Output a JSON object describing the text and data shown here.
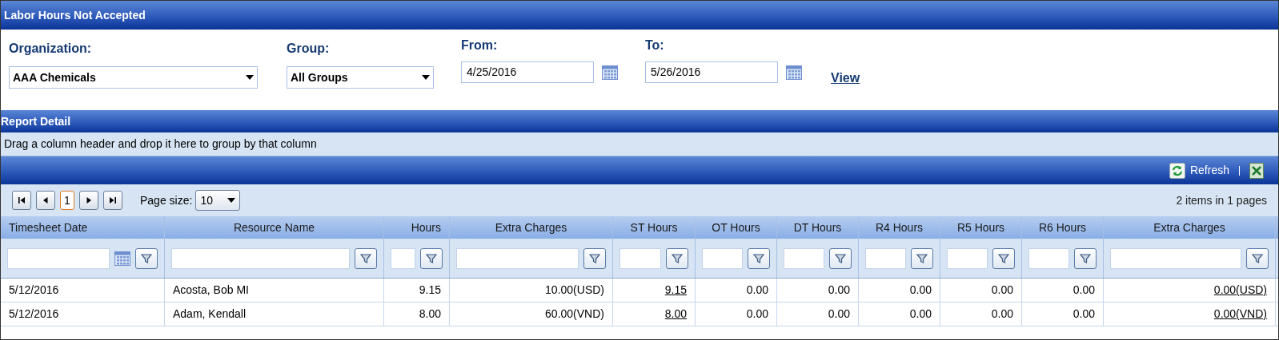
{
  "title": "Labor Hours Not Accepted",
  "filters": [
    {
      "kind": "select",
      "label": "Organization:",
      "value": "AAA Chemicals"
    },
    {
      "kind": "select",
      "label": "Group:",
      "value": "All Groups"
    },
    {
      "kind": "date",
      "label": "From:",
      "value": "4/25/2016"
    },
    {
      "kind": "date",
      "label": "To:",
      "value": "5/26/2016"
    }
  ],
  "view_link": "View",
  "section_title": "Report Detail",
  "group_hint": "Drag a column header and drop it here to group by that column",
  "toolbar": {
    "refresh": "Refresh"
  },
  "pager": {
    "pages": [
      {
        "label": "1",
        "selected": true
      }
    ],
    "page_size_label": "Page size:",
    "page_size": "10",
    "summary": "2 items in 1 pages"
  },
  "table": {
    "columns": [
      {
        "label": "Timesheet Date",
        "kind": "date"
      },
      {
        "label": "Resource Name",
        "kind": "text"
      },
      {
        "label": "Hours",
        "kind": "text"
      },
      {
        "label": "Extra Charges",
        "kind": "text"
      },
      {
        "label": "ST Hours",
        "kind": "text"
      },
      {
        "label": "OT Hours",
        "kind": "text"
      },
      {
        "label": "DT Hours",
        "kind": "text"
      },
      {
        "label": "R4 Hours",
        "kind": "text"
      },
      {
        "label": "R5 Hours",
        "kind": "text"
      },
      {
        "label": "R6 Hours",
        "kind": "text"
      },
      {
        "label": "Extra Charges",
        "kind": "text"
      }
    ],
    "rows": [
      {
        "cells": [
          {
            "text": "5/12/2016",
            "link": false
          },
          {
            "text": "Acosta, Bob MI",
            "link": false
          },
          {
            "text": "9.15",
            "link": false
          },
          {
            "text": "10.00(USD)",
            "link": false
          },
          {
            "text": "9.15",
            "link": true
          },
          {
            "text": "0.00",
            "link": false
          },
          {
            "text": "0.00",
            "link": false
          },
          {
            "text": "0.00",
            "link": false
          },
          {
            "text": "0.00",
            "link": false
          },
          {
            "text": "0.00",
            "link": false
          },
          {
            "text": "0.00(USD)",
            "link": true
          }
        ]
      },
      {
        "cells": [
          {
            "text": "5/12/2016",
            "link": false
          },
          {
            "text": "Adam, Kendall",
            "link": false
          },
          {
            "text": "8.00",
            "link": false
          },
          {
            "text": "60.00(VND)",
            "link": false
          },
          {
            "text": "8.00",
            "link": true
          },
          {
            "text": "0.00",
            "link": false
          },
          {
            "text": "0.00",
            "link": false
          },
          {
            "text": "0.00",
            "link": false
          },
          {
            "text": "0.00",
            "link": false
          },
          {
            "text": "0.00",
            "link": false
          },
          {
            "text": "0.00(VND)",
            "link": true
          }
        ]
      }
    ]
  }
}
